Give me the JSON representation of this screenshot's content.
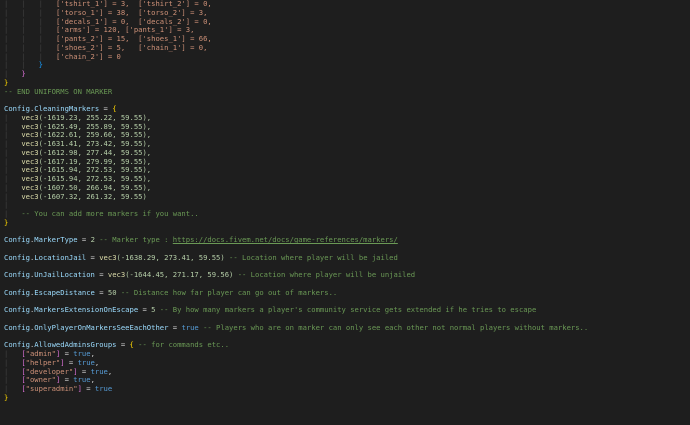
{
  "lines": [
    [
      {
        "t": "|   |   |   ",
        "c": "guide"
      },
      {
        "t": "['tshirt_1'] = 3,  ['tshirt_2'] = 0,",
        "c": "str"
      }
    ],
    [
      {
        "t": "|   |   |   ",
        "c": "guide"
      },
      {
        "t": "['torso_1'] = 38,  ['torso_2'] = 3,",
        "c": "str"
      }
    ],
    [
      {
        "t": "|   |   |   ",
        "c": "guide"
      },
      {
        "t": "['decals_1'] = 0,  ['decals_2'] = 0,",
        "c": "str"
      }
    ],
    [
      {
        "t": "|   |   |   ",
        "c": "guide"
      },
      {
        "t": "['arms'] = 120, ['pants_1'] = 3,",
        "c": "str"
      }
    ],
    [
      {
        "t": "|   |   |   ",
        "c": "guide"
      },
      {
        "t": "['pants_2'] = 15,  ['shoes_1'] = 66,",
        "c": "str"
      }
    ],
    [
      {
        "t": "|   |   |   ",
        "c": "guide"
      },
      {
        "t": "['shoes_2'] = 5,   ['chain_1'] = 0,",
        "c": "str"
      }
    ],
    [
      {
        "t": "|   |   |   ",
        "c": "guide"
      },
      {
        "t": "['chain_2'] = 0",
        "c": "str"
      }
    ],
    [
      {
        "t": "|   |   ",
        "c": "guide"
      },
      {
        "t": "}",
        "c": "bracket-b"
      }
    ],
    [
      {
        "t": "|   ",
        "c": "guide"
      },
      {
        "t": "}",
        "c": "bracket-p"
      }
    ],
    [
      {
        "t": "}",
        "c": "bracket-y"
      }
    ],
    [
      {
        "t": "-- END UNIFORMS ON MARKER",
        "c": "comment"
      }
    ],
    [
      {
        "t": "",
        "c": "plain"
      }
    ],
    [
      {
        "t": "Config",
        "c": "var"
      },
      {
        "t": ".",
        "c": "plain"
      },
      {
        "t": "CleaningMarkers",
        "c": "var"
      },
      {
        "t": " = ",
        "c": "plain"
      },
      {
        "t": "{",
        "c": "bracket-y"
      }
    ],
    [
      {
        "t": "|   ",
        "c": "guide"
      },
      {
        "t": "vec3",
        "c": "fn"
      },
      {
        "t": "(-1619.23, 255.22, 59.55),",
        "c": "num"
      }
    ],
    [
      {
        "t": "|   ",
        "c": "guide"
      },
      {
        "t": "vec3",
        "c": "fn"
      },
      {
        "t": "(-1625.49, 255.89, 59.55),",
        "c": "num"
      }
    ],
    [
      {
        "t": "|   ",
        "c": "guide"
      },
      {
        "t": "vec3",
        "c": "fn"
      },
      {
        "t": "(-1622.61, 259.66, 59.55),",
        "c": "num"
      }
    ],
    [
      {
        "t": "|   ",
        "c": "guide"
      },
      {
        "t": "vec3",
        "c": "fn"
      },
      {
        "t": "(-1631.41, 273.42, 59.55),",
        "c": "num"
      }
    ],
    [
      {
        "t": "|   ",
        "c": "guide"
      },
      {
        "t": "vec3",
        "c": "fn"
      },
      {
        "t": "(-1612.98, 277.44, 59.55),",
        "c": "num"
      }
    ],
    [
      {
        "t": "|   ",
        "c": "guide"
      },
      {
        "t": "vec3",
        "c": "fn"
      },
      {
        "t": "(-1617.19, 279.99, 59.55),",
        "c": "num"
      }
    ],
    [
      {
        "t": "|   ",
        "c": "guide"
      },
      {
        "t": "vec3",
        "c": "fn"
      },
      {
        "t": "(-1615.94, 272.53, 59.55),",
        "c": "num"
      }
    ],
    [
      {
        "t": "|   ",
        "c": "guide"
      },
      {
        "t": "vec3",
        "c": "fn"
      },
      {
        "t": "(-1615.94, 272.53, 59.55),",
        "c": "num"
      }
    ],
    [
      {
        "t": "|   ",
        "c": "guide"
      },
      {
        "t": "vec3",
        "c": "fn"
      },
      {
        "t": "(-1607.50, 266.94, 59.55),",
        "c": "num"
      }
    ],
    [
      {
        "t": "|   ",
        "c": "guide"
      },
      {
        "t": "vec3",
        "c": "fn"
      },
      {
        "t": "(-1607.32, 261.32, 59.55)",
        "c": "num"
      }
    ],
    [
      {
        "t": "|   ",
        "c": "guide"
      }
    ],
    [
      {
        "t": "|   ",
        "c": "guide"
      },
      {
        "t": "-- You can add more markers if you want..",
        "c": "comment"
      }
    ],
    [
      {
        "t": "}",
        "c": "bracket-y"
      }
    ],
    [
      {
        "t": "",
        "c": "plain"
      }
    ],
    [
      {
        "t": "Config",
        "c": "var"
      },
      {
        "t": ".",
        "c": "plain"
      },
      {
        "t": "MarkerType",
        "c": "var"
      },
      {
        "t": " = ",
        "c": "plain"
      },
      {
        "t": "2",
        "c": "num"
      },
      {
        "t": " -- Marker type : ",
        "c": "comment"
      },
      {
        "t": "https://docs.fivem.net/docs/game-references/markers/",
        "c": "link"
      }
    ],
    [
      {
        "t": "",
        "c": "plain"
      }
    ],
    [
      {
        "t": "Config",
        "c": "var"
      },
      {
        "t": ".",
        "c": "plain"
      },
      {
        "t": "LocationJail",
        "c": "var"
      },
      {
        "t": " = ",
        "c": "plain"
      },
      {
        "t": "vec3",
        "c": "fn"
      },
      {
        "t": "(-1638.29, 273.41, 59.55)",
        "c": "num"
      },
      {
        "t": " -- Location where player will be jailed",
        "c": "comment"
      }
    ],
    [
      {
        "t": "",
        "c": "plain"
      }
    ],
    [
      {
        "t": "Config",
        "c": "var"
      },
      {
        "t": ".",
        "c": "plain"
      },
      {
        "t": "UnJailLocation",
        "c": "var"
      },
      {
        "t": " = ",
        "c": "plain"
      },
      {
        "t": "vec3",
        "c": "fn"
      },
      {
        "t": "(-1644.45, 271.17, 59.56)",
        "c": "num"
      },
      {
        "t": " -- Location where player will be unjailed",
        "c": "comment"
      }
    ],
    [
      {
        "t": "",
        "c": "plain"
      }
    ],
    [
      {
        "t": "Config",
        "c": "var"
      },
      {
        "t": ".",
        "c": "plain"
      },
      {
        "t": "EscapeDistance",
        "c": "var"
      },
      {
        "t": " = ",
        "c": "plain"
      },
      {
        "t": "50",
        "c": "num"
      },
      {
        "t": " -- Distance how far player can go out of markers..",
        "c": "comment"
      }
    ],
    [
      {
        "t": "",
        "c": "plain"
      }
    ],
    [
      {
        "t": "Config",
        "c": "var"
      },
      {
        "t": ".",
        "c": "plain"
      },
      {
        "t": "MarkersExtensionOnEscape",
        "c": "var"
      },
      {
        "t": " = ",
        "c": "plain"
      },
      {
        "t": "5",
        "c": "num"
      },
      {
        "t": " -- By how many markers a player's community service gets extended if he tries to escape",
        "c": "comment"
      }
    ],
    [
      {
        "t": "",
        "c": "plain"
      }
    ],
    [
      {
        "t": "Config",
        "c": "var"
      },
      {
        "t": ".",
        "c": "plain"
      },
      {
        "t": "OnlyPlayerOnMarkersSeeEachOther",
        "c": "var"
      },
      {
        "t": " = ",
        "c": "plain"
      },
      {
        "t": "true",
        "c": "keyword"
      },
      {
        "t": " -- Players who are on marker can only see each other not normal players without markers..",
        "c": "comment"
      }
    ],
    [
      {
        "t": "",
        "c": "plain"
      }
    ],
    [
      {
        "t": "Config",
        "c": "var"
      },
      {
        "t": ".",
        "c": "plain"
      },
      {
        "t": "AllowedAdminsGroups",
        "c": "var"
      },
      {
        "t": " = ",
        "c": "plain"
      },
      {
        "t": "{",
        "c": "bracket-y"
      },
      {
        "t": " -- for commands etc..",
        "c": "comment"
      }
    ],
    [
      {
        "t": "|   ",
        "c": "guide"
      },
      {
        "t": "[",
        "c": "bracket-p"
      },
      {
        "t": "\"admin\"",
        "c": "str"
      },
      {
        "t": "]",
        "c": "bracket-p"
      },
      {
        "t": " = ",
        "c": "plain"
      },
      {
        "t": "true",
        "c": "keyword"
      },
      {
        "t": ",",
        "c": "plain"
      }
    ],
    [
      {
        "t": "|   ",
        "c": "guide"
      },
      {
        "t": "[",
        "c": "bracket-p"
      },
      {
        "t": "\"helper\"",
        "c": "str"
      },
      {
        "t": "]",
        "c": "bracket-p"
      },
      {
        "t": " = ",
        "c": "plain"
      },
      {
        "t": "true",
        "c": "keyword"
      },
      {
        "t": ",",
        "c": "plain"
      }
    ],
    [
      {
        "t": "|   ",
        "c": "guide"
      },
      {
        "t": "[",
        "c": "bracket-p"
      },
      {
        "t": "\"developer\"",
        "c": "str"
      },
      {
        "t": "]",
        "c": "bracket-p"
      },
      {
        "t": " = ",
        "c": "plain"
      },
      {
        "t": "true",
        "c": "keyword"
      },
      {
        "t": ",",
        "c": "plain"
      }
    ],
    [
      {
        "t": "|   ",
        "c": "guide"
      },
      {
        "t": "[",
        "c": "bracket-p"
      },
      {
        "t": "\"owner\"",
        "c": "str"
      },
      {
        "t": "]",
        "c": "bracket-p"
      },
      {
        "t": " = ",
        "c": "plain"
      },
      {
        "t": "true",
        "c": "keyword"
      },
      {
        "t": ",",
        "c": "plain"
      }
    ],
    [
      {
        "t": "|   ",
        "c": "guide"
      },
      {
        "t": "[",
        "c": "bracket-p"
      },
      {
        "t": "\"superadmin\"",
        "c": "str"
      },
      {
        "t": "]",
        "c": "bracket-p"
      },
      {
        "t": " = ",
        "c": "plain"
      },
      {
        "t": "true",
        "c": "keyword"
      }
    ],
    [
      {
        "t": "}",
        "c": "bracket-y"
      }
    ]
  ]
}
